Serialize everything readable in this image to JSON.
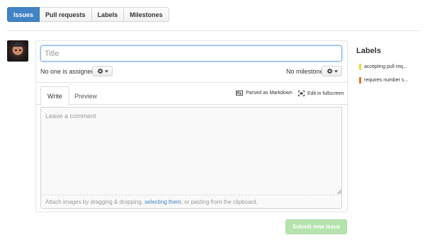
{
  "nav": {
    "tabs": [
      {
        "label": "Issues",
        "selected": true
      },
      {
        "label": "Pull requests",
        "selected": false
      },
      {
        "label": "Labels",
        "selected": false
      },
      {
        "label": "Milestones",
        "selected": false
      }
    ]
  },
  "form": {
    "title_placeholder": "Title",
    "title_value": "",
    "assignee_text": "No one is assigned",
    "milestone_text": "No milestone",
    "tabs": {
      "write": "Write",
      "preview": "Preview"
    },
    "parsed_markdown": "Parsed as Markdown",
    "edit_fullscreen": "Edit in fullscreen",
    "comment_placeholder": "Leave a comment",
    "comment_value": "",
    "attach": {
      "before": "Attach images by dragging & dropping, ",
      "link": "selecting them",
      "after": ", or pasting from the clipboard."
    },
    "submit_label": "Submit new issue"
  },
  "sidebar": {
    "heading": "Labels",
    "labels": [
      {
        "name": "accepting pull req...",
        "color": "#e8d93a"
      },
      {
        "name": "requires number s...",
        "color": "#e07b24"
      }
    ]
  },
  "colors": {
    "accent": "#4183c4",
    "submit_disabled": "#b6e3ad"
  },
  "icons": {
    "gear": "gear-icon",
    "markdown": "markdown-icon",
    "fullscreen": "fullscreen-icon"
  }
}
